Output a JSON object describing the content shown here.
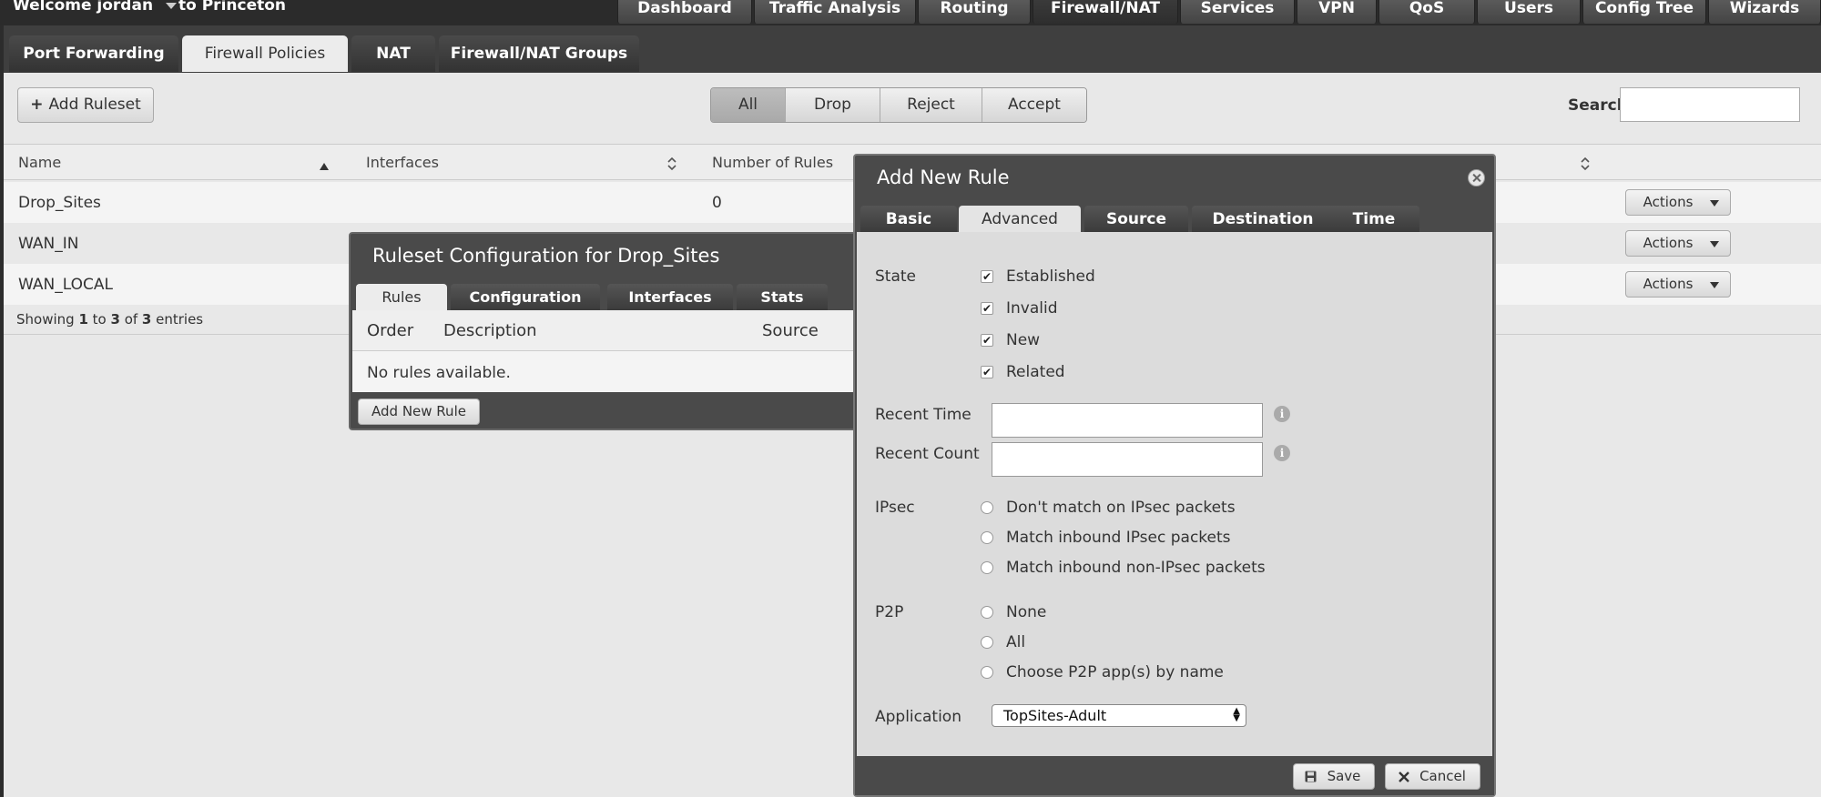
{
  "topbar": {
    "welcome": "Welcome jordan",
    "router": "to Princeton",
    "tabs": [
      {
        "label": "Dashboard"
      },
      {
        "label": "Traffic Analysis"
      },
      {
        "label": "Routing"
      },
      {
        "label": "Firewall/NAT"
      },
      {
        "label": "Services"
      },
      {
        "label": "VPN"
      },
      {
        "label": "QoS"
      },
      {
        "label": "Users"
      },
      {
        "label": "Config Tree"
      },
      {
        "label": "Wizards"
      }
    ],
    "active_tab": "Firewall/NAT"
  },
  "subtabs": [
    {
      "label": "Port Forwarding"
    },
    {
      "label": "Firewall Policies"
    },
    {
      "label": "NAT"
    },
    {
      "label": "Firewall/NAT Groups"
    }
  ],
  "active_subtab": "Firewall Policies",
  "toolbar": {
    "add_ruleset": "Add Ruleset",
    "add_icon": "+",
    "filters": [
      {
        "label": "All"
      },
      {
        "label": "Drop"
      },
      {
        "label": "Reject"
      },
      {
        "label": "Accept"
      }
    ],
    "active_filter": "All",
    "search_label": "Search",
    "search_value": ""
  },
  "table": {
    "columns": [
      "Name",
      "Interfaces",
      "Number of Rules"
    ],
    "rows": [
      {
        "name": "Drop_Sites",
        "interfaces": "",
        "rules": "0",
        "actions": "Actions"
      },
      {
        "name": "WAN_IN",
        "interfaces": "",
        "rules": "",
        "actions": "Actions"
      },
      {
        "name": "WAN_LOCAL",
        "interfaces": "",
        "rules": "",
        "actions": "Actions"
      }
    ],
    "showing_prefix": "Showing ",
    "showing_from": "1",
    "showing_to_word": " to ",
    "showing_to": "3",
    "showing_of_word": " of ",
    "showing_total": "3",
    "showing_suffix": " entries"
  },
  "ruleset_dialog": {
    "title": "Ruleset Configuration for Drop_Sites",
    "tabs": [
      {
        "label": "Rules"
      },
      {
        "label": "Configuration"
      },
      {
        "label": "Interfaces"
      },
      {
        "label": "Stats"
      }
    ],
    "active_tab": "Rules",
    "columns": [
      "Order",
      "Description",
      "Source"
    ],
    "empty_text": "No rules available.",
    "add_button": "Add New Rule"
  },
  "rule_dialog": {
    "title": "Add New Rule",
    "tabs": [
      {
        "label": "Basic"
      },
      {
        "label": "Advanced"
      },
      {
        "label": "Source"
      },
      {
        "label": "Destination"
      },
      {
        "label": "Time"
      }
    ],
    "active_tab": "Advanced",
    "state_label": "State",
    "states": [
      {
        "label": "Established",
        "checked": true
      },
      {
        "label": "Invalid",
        "checked": true
      },
      {
        "label": "New",
        "checked": true
      },
      {
        "label": "Related",
        "checked": true
      }
    ],
    "recent_time_label": "Recent Time",
    "recent_time_value": "",
    "recent_count_label": "Recent Count",
    "recent_count_value": "",
    "info_glyph": "i",
    "ipsec_label": "IPsec",
    "ipsec_options": [
      {
        "label": "Don't match on IPsec packets",
        "selected": false
      },
      {
        "label": "Match inbound IPsec packets",
        "selected": false
      },
      {
        "label": "Match inbound non-IPsec packets",
        "selected": false
      }
    ],
    "p2p_label": "P2P",
    "p2p_options": [
      {
        "label": "None",
        "selected": false
      },
      {
        "label": "All",
        "selected": false
      },
      {
        "label": "Choose P2P app(s) by name",
        "selected": false
      }
    ],
    "application_label": "Application",
    "application_value": "TopSites-Adult",
    "save_label": "Save",
    "cancel_label": "Cancel"
  }
}
